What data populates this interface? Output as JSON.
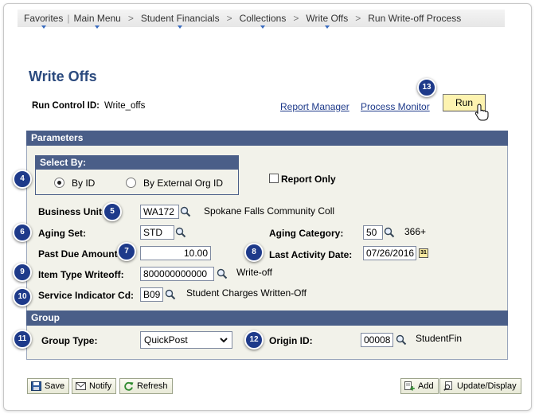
{
  "breadcrumb": {
    "favorites": "Favorites",
    "main_menu": "Main Menu",
    "items": [
      "Student Financials",
      "Collections",
      "Write Offs",
      "Run Write-off Process"
    ],
    "separator": ">"
  },
  "page": {
    "title": "Write Offs",
    "run_control_label": "Run Control ID:",
    "run_control_value": "Write_offs",
    "report_manager": "Report Manager",
    "process_monitor": "Process Monitor",
    "run_label": "Run"
  },
  "parameters": {
    "header": "Parameters",
    "select_by": {
      "header": "Select By:",
      "option_id": "By ID",
      "option_external": "By External Org ID",
      "selected": "By ID"
    },
    "report_only_label": "Report Only",
    "report_only_checked": false,
    "business_unit": {
      "label": "Business Unit",
      "value": "WA172",
      "description": "Spokane Falls Community Coll"
    },
    "aging_set": {
      "label": "Aging Set:",
      "value": "STD"
    },
    "aging_category": {
      "label": "Aging Category:",
      "value": "50",
      "description": "366+"
    },
    "past_due_amount": {
      "label": "Past Due Amount",
      "value": "10.00"
    },
    "last_activity_date": {
      "label": "Last Activity Date:",
      "value": "07/26/2016",
      "calendar_glyph": "31"
    },
    "item_type_writeoff": {
      "label": "Item Type Writeoff:",
      "value": "800000000000",
      "description": "Write-off"
    },
    "service_indicator": {
      "label": "Service Indicator Cd:",
      "value": "B09",
      "description": "Student Charges Written-Off"
    }
  },
  "group": {
    "header": "Group",
    "group_type": {
      "label": "Group Type:",
      "value": "QuickPost"
    },
    "origin_id": {
      "label": "Origin ID:",
      "value": "00008",
      "description": "StudentFin"
    }
  },
  "toolbar": {
    "save": "Save",
    "notify": "Notify",
    "refresh": "Refresh",
    "add": "Add",
    "update_display": "Update/Display"
  },
  "callouts": [
    "4",
    "5",
    "6",
    "7",
    "8",
    "9",
    "10",
    "11",
    "12",
    "13"
  ],
  "colors": {
    "section_header": "#4a5e88",
    "page_title": "#2b4a7e",
    "run_button": "#fdf3b0",
    "callout": "#1e3a8a",
    "panel_background": "#f2f2ea"
  },
  "icons": {
    "lookup": "magnifier-icon",
    "calendar": "calendar-icon",
    "cursor": "hand-pointer-icon",
    "save": "save-disk-icon",
    "notify": "notify-icon",
    "refresh": "refresh-icon",
    "add": "add-icon",
    "update": "update-display-icon"
  }
}
